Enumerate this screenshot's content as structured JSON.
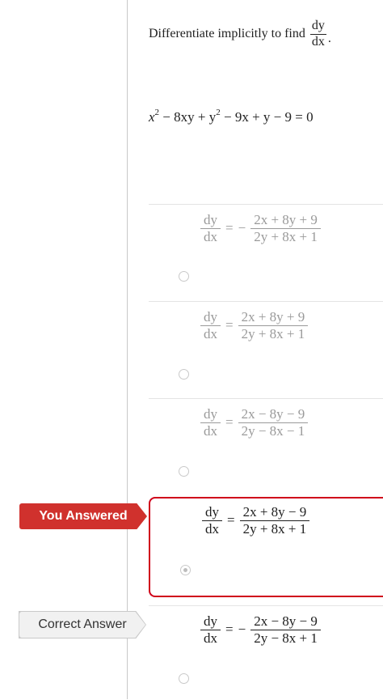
{
  "question": {
    "prefix": "Differentiate implicitly to find",
    "frac_num": "dy",
    "frac_den": "dx",
    "suffix": "."
  },
  "equation": {
    "t1": "x",
    "t1_exp": "2",
    "t2": " − 8xy + y",
    "t2_exp": "2",
    "t3": " − 9x + y − 9 = 0"
  },
  "options": [
    {
      "lhs_num": "dy",
      "lhs_den": "dx",
      "eq": "=",
      "sign": "−",
      "num": "2x + 8y + 9",
      "den": "2y + 8x + 1"
    },
    {
      "lhs_num": "dy",
      "lhs_den": "dx",
      "eq": "=",
      "sign": "",
      "num": "2x + 8y + 9",
      "den": "2y + 8x + 1"
    },
    {
      "lhs_num": "dy",
      "lhs_den": "dx",
      "eq": "=",
      "sign": "",
      "num": "2x − 8y − 9",
      "den": "2y − 8x − 1"
    },
    {
      "lhs_num": "dy",
      "lhs_den": "dx",
      "eq": "=",
      "sign": "",
      "num": "2x + 8y − 9",
      "den": "2y + 8x + 1"
    },
    {
      "lhs_num": "dy",
      "lhs_den": "dx",
      "eq": "=",
      "sign": "−",
      "num": "2x − 8y − 9",
      "den": "2y − 8x + 1"
    }
  ],
  "labels": {
    "you_answered": "You Answered",
    "correct_answer": "Correct Answer"
  },
  "colors": {
    "selected_border": "#d0021b",
    "you_answered_bg": "#d0312d",
    "correct_bg": "#f1f1f1"
  }
}
